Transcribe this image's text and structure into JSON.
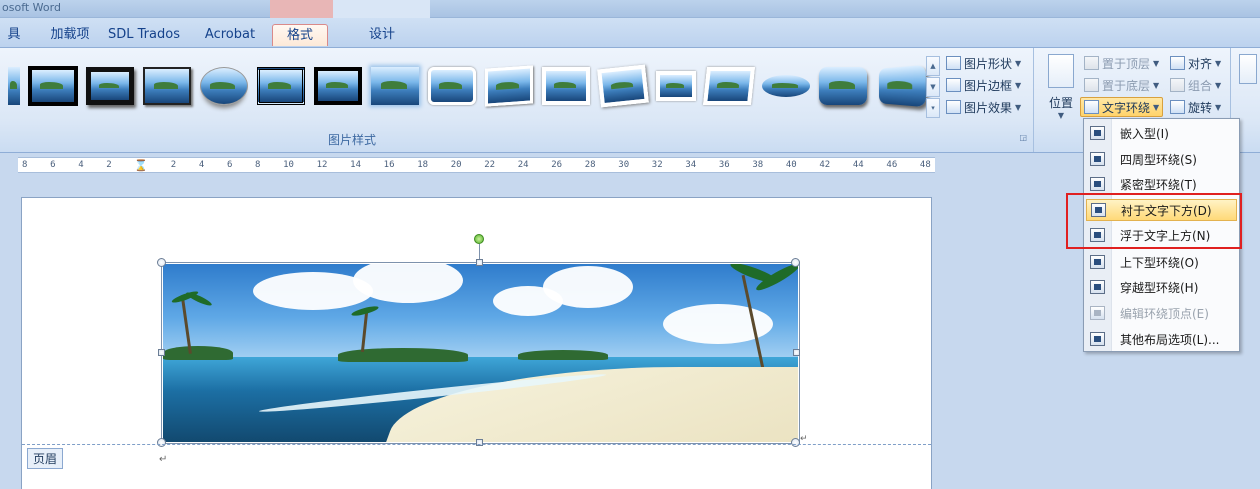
{
  "title_bar": {
    "app_title": "osoft Word"
  },
  "tabs": [
    {
      "label": "具"
    },
    {
      "label": "加载项"
    },
    {
      "label": "SDL Trados"
    },
    {
      "label": "Acrobat"
    },
    {
      "label": "格式",
      "active": true
    },
    {
      "label": "设计"
    }
  ],
  "ribbon": {
    "picture_styles": {
      "group_label": "图片样式",
      "shape_btn": "图片形状",
      "border_btn": "图片边框",
      "effects_btn": "图片效果"
    },
    "arrange": {
      "position_btn": "位置",
      "bring_front": "置于顶层",
      "send_back": "置于底层",
      "text_wrap": "文字环绕",
      "align": "对齐",
      "group": "组合",
      "rotate": "旋转"
    }
  },
  "ruler": {
    "ticks": [
      "8",
      "6",
      "4",
      "2",
      "",
      "2",
      "4",
      "6",
      "8",
      "10",
      "12",
      "14",
      "16",
      "18",
      "20",
      "22",
      "24",
      "26",
      "28",
      "30",
      "32",
      "34",
      "36",
      "38",
      "40",
      "42",
      "44",
      "46",
      "48"
    ]
  },
  "document": {
    "header_label": "页眉"
  },
  "wrap_menu": {
    "items": [
      {
        "label": "嵌入型(I)"
      },
      {
        "label": "四周型环绕(S)"
      },
      {
        "label": "紧密型环绕(T)"
      },
      {
        "label": "衬于文字下方(D)",
        "highlighted": true
      },
      {
        "label": "浮于文字上方(N)"
      },
      {
        "label": "上下型环绕(O)"
      },
      {
        "label": "穿越型环绕(H)"
      },
      {
        "label": "编辑环绕顶点(E)",
        "disabled": true
      },
      {
        "label": "其他布局选项(L)..."
      }
    ]
  },
  "colors": {
    "accent": "#e02020",
    "ribbon": "#dbe7f6",
    "highlight": "#ffd978"
  }
}
